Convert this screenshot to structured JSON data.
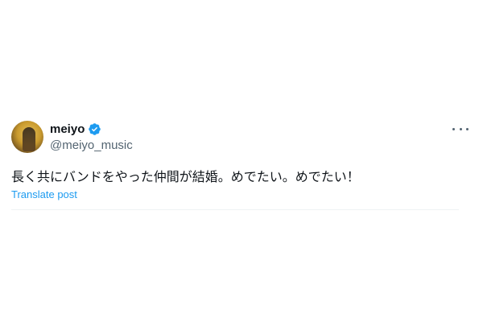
{
  "post": {
    "display_name": "meiyo",
    "handle": "@meiyo_music",
    "verified": true,
    "text": "長く共にバンドをやった仲間が結婚。めでたい。めでたい！",
    "translate_label": "Translate post",
    "more_icon": "more-horizontal-icon"
  },
  "colors": {
    "text_primary": "#0f1419",
    "text_secondary": "#536471",
    "link": "#1d9bf0",
    "verified_badge": "#1d9bf0"
  }
}
